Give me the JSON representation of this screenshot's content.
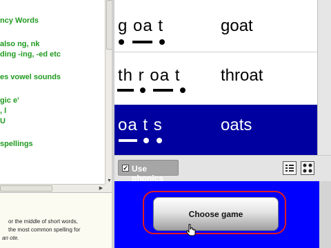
{
  "sidebar": {
    "items": [
      {
        "label": "ncy Words"
      },
      {
        "label": "also ng, nk"
      },
      {
        "label": "ding -ing, -ed  etc"
      },
      {
        "label": "es vowel sounds"
      },
      {
        "label": "gic e'"
      },
      {
        "label": ", l"
      },
      {
        "label": "U"
      },
      {
        "label": " spellings"
      }
    ],
    "info_lines": [
      "or the middle of short words,",
      "the most common spelling for",
      "an ote."
    ]
  },
  "word_list": {
    "rows": [
      {
        "phonics": "g oa t",
        "word": "goat",
        "selected": false,
        "marks": [
          "dot",
          "bar",
          "dot"
        ]
      },
      {
        "phonics": "th r oa t",
        "word": "throat",
        "selected": false,
        "marks": [
          "bar",
          "dot",
          "bar",
          "dot"
        ]
      },
      {
        "phonics": "oa t s",
        "word": "oats",
        "selected": true,
        "marks": [
          "bar",
          "dot",
          "dot"
        ]
      }
    ]
  },
  "controls": {
    "use_phonics_label": "Use phonics",
    "use_phonics_checked": true,
    "view_buttons": [
      "list-view-icon",
      "grid-view-icon"
    ]
  },
  "game": {
    "choose_game_label": "Choose game"
  },
  "colors": {
    "sidebar_text": "#1f9a1f",
    "selected_row": "#0000a0",
    "bottom_panel": "#0000ff",
    "highlight_ring": "#e21c1c"
  }
}
